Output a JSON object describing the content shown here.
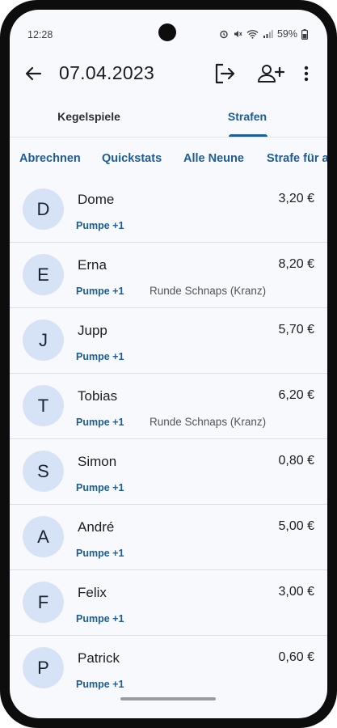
{
  "status_bar": {
    "time": "12:28",
    "battery": "59%",
    "icons": [
      "alarm-icon",
      "mute-icon",
      "wifi-icon",
      "signal-icon",
      "battery-icon"
    ]
  },
  "app_bar": {
    "title": "07.04.2023",
    "back_icon": "arrow-left-icon",
    "exit_icon": "logout-icon",
    "add_user_icon": "person-add-icon",
    "more_icon": "more-vert-icon"
  },
  "tabs": [
    {
      "label": "Kegelspiele",
      "selected": false
    },
    {
      "label": "Strafen",
      "selected": true
    }
  ],
  "actions": [
    "Abrechnen",
    "Quickstats",
    "Alle Neune",
    "Strafe für a"
  ],
  "players": [
    {
      "initial": "D",
      "name": "Dome",
      "amount": "3,20 €",
      "chips": [
        "Pumpe +1"
      ]
    },
    {
      "initial": "E",
      "name": "Erna",
      "amount": "8,20 €",
      "chips": [
        "Pumpe +1",
        "Runde Schnaps (Kranz)"
      ]
    },
    {
      "initial": "J",
      "name": "Jupp",
      "amount": "5,70 €",
      "chips": [
        "Pumpe +1"
      ]
    },
    {
      "initial": "T",
      "name": "Tobias",
      "amount": "6,20 €",
      "chips": [
        "Pumpe +1",
        "Runde Schnaps (Kranz)"
      ]
    },
    {
      "initial": "S",
      "name": "Simon",
      "amount": "0,80 €",
      "chips": [
        "Pumpe +1"
      ]
    },
    {
      "initial": "A",
      "name": "André",
      "amount": "5,00 €",
      "chips": [
        "Pumpe +1"
      ]
    },
    {
      "initial": "F",
      "name": "Felix",
      "amount": "3,00 €",
      "chips": [
        "Pumpe +1"
      ]
    },
    {
      "initial": "P",
      "name": "Patrick",
      "amount": "0,60 €",
      "chips": [
        "Pumpe +1"
      ]
    }
  ],
  "colors": {
    "accent": "#1c5d97",
    "avatar_bg": "#d6e3f6",
    "background": "#f8f9fc"
  }
}
